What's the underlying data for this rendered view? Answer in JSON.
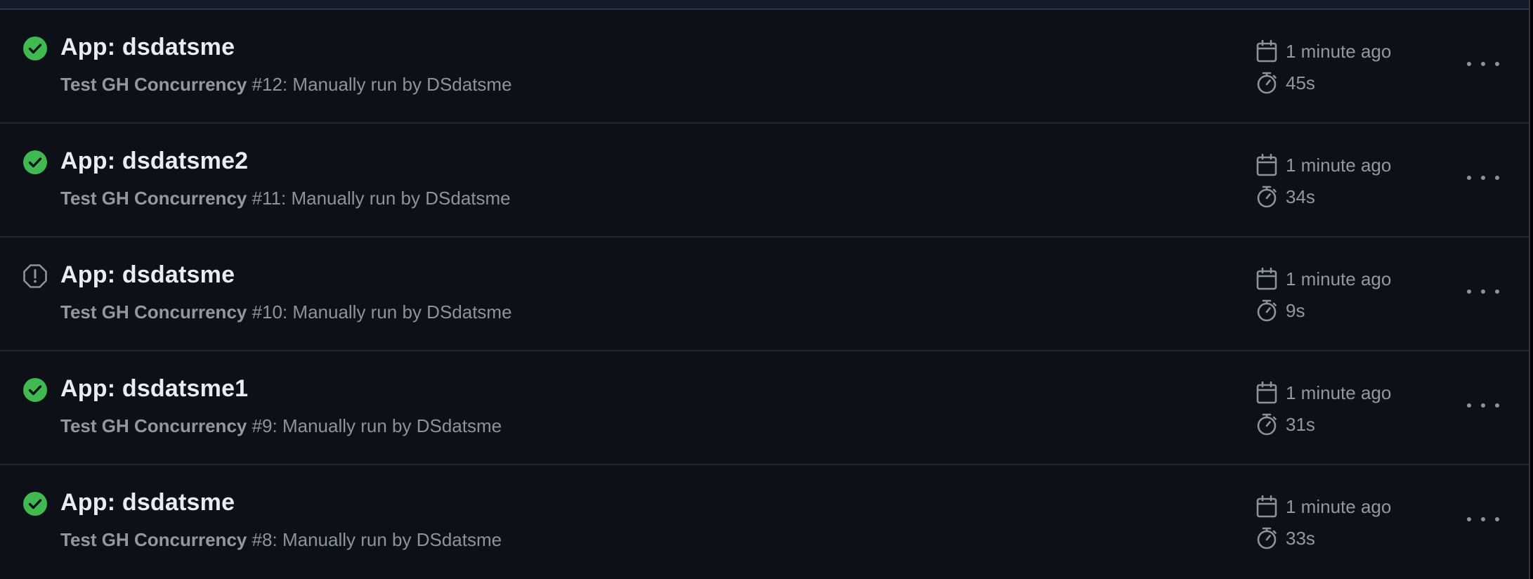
{
  "colors": {
    "success": "#3fb950",
    "neutral_icon": "#8b949e",
    "background": "#0d1117"
  },
  "runs": [
    {
      "status": "success",
      "status_icon": "check-circle-icon",
      "title": "App: dsdatsme",
      "workflow": "Test GH Concurrency",
      "run_info": " #12: Manually run by DSdatsme",
      "time": "1 minute ago",
      "duration": "45s"
    },
    {
      "status": "success",
      "status_icon": "check-circle-icon",
      "title": "App: dsdatsme2",
      "workflow": "Test GH Concurrency",
      "run_info": " #11: Manually run by DSdatsme",
      "time": "1 minute ago",
      "duration": "34s"
    },
    {
      "status": "cancelled",
      "status_icon": "stop-octagon-icon",
      "title": "App: dsdatsme",
      "workflow": "Test GH Concurrency",
      "run_info": " #10: Manually run by DSdatsme",
      "time": "1 minute ago",
      "duration": "9s"
    },
    {
      "status": "success",
      "status_icon": "check-circle-icon",
      "title": "App: dsdatsme1",
      "workflow": "Test GH Concurrency",
      "run_info": " #9: Manually run by DSdatsme",
      "time": "1 minute ago",
      "duration": "31s"
    },
    {
      "status": "success",
      "status_icon": "check-circle-icon",
      "title": "App: dsdatsme",
      "workflow": "Test GH Concurrency",
      "run_info": " #8: Manually run by DSdatsme",
      "time": "1 minute ago",
      "duration": "33s"
    }
  ]
}
